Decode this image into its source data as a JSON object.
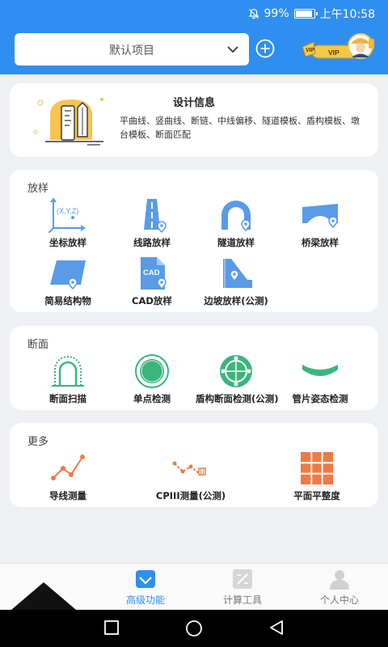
{
  "status_bar": {
    "battery_percent": "99%",
    "time": "上午10:58",
    "battery_level": 0.99
  },
  "header": {
    "project_selected": "默认项目",
    "vip_label": "VIP"
  },
  "info_card": {
    "title": "设计信息",
    "description": "平曲线、竖曲线、断链、中线偏移、隧道模板、盾构模板、墩台模板、断面匹配"
  },
  "sections": {
    "fangyang": {
      "title": "放样",
      "items": [
        {
          "label": "坐标放样",
          "icon": "coordinate-icon"
        },
        {
          "label": "线路放样",
          "icon": "route-icon"
        },
        {
          "label": "隧道放样",
          "icon": "tunnel-icon"
        },
        {
          "label": "桥梁放样",
          "icon": "bridge-icon"
        },
        {
          "label": "简易结构物",
          "icon": "structure-icon"
        },
        {
          "label": "CAD放样",
          "icon": "cad-file-icon"
        },
        {
          "label": "边坡放样(公测)",
          "icon": "slope-icon"
        }
      ],
      "coord_icon_text": "(X,Y,Z)",
      "cad_icon_text": "CAD"
    },
    "duanmian": {
      "title": "断面",
      "items": [
        {
          "label": "断面扫描",
          "icon": "section-scan-icon"
        },
        {
          "label": "单点检测",
          "icon": "single-point-icon"
        },
        {
          "label": "盾构断面检测(公测)",
          "icon": "shield-section-icon"
        },
        {
          "label": "管片姿态检测",
          "icon": "segment-pose-icon"
        }
      ]
    },
    "gengduo": {
      "title": "更多",
      "items": [
        {
          "label": "导线测量",
          "icon": "traverse-icon"
        },
        {
          "label": "CPIII测量(公测)",
          "icon": "cpiii-icon"
        },
        {
          "label": "平面平整度",
          "icon": "flatness-icon"
        }
      ]
    }
  },
  "bottom_nav": [
    {
      "label": "高级功能",
      "active": true
    },
    {
      "label": "计算工具",
      "active": false
    },
    {
      "label": "个人中心",
      "active": false
    }
  ],
  "colors": {
    "primary": "#2f8ff0",
    "icon_blue": "#5a9be8",
    "icon_green": "#3ab67d",
    "icon_orange": "#f07a45"
  }
}
